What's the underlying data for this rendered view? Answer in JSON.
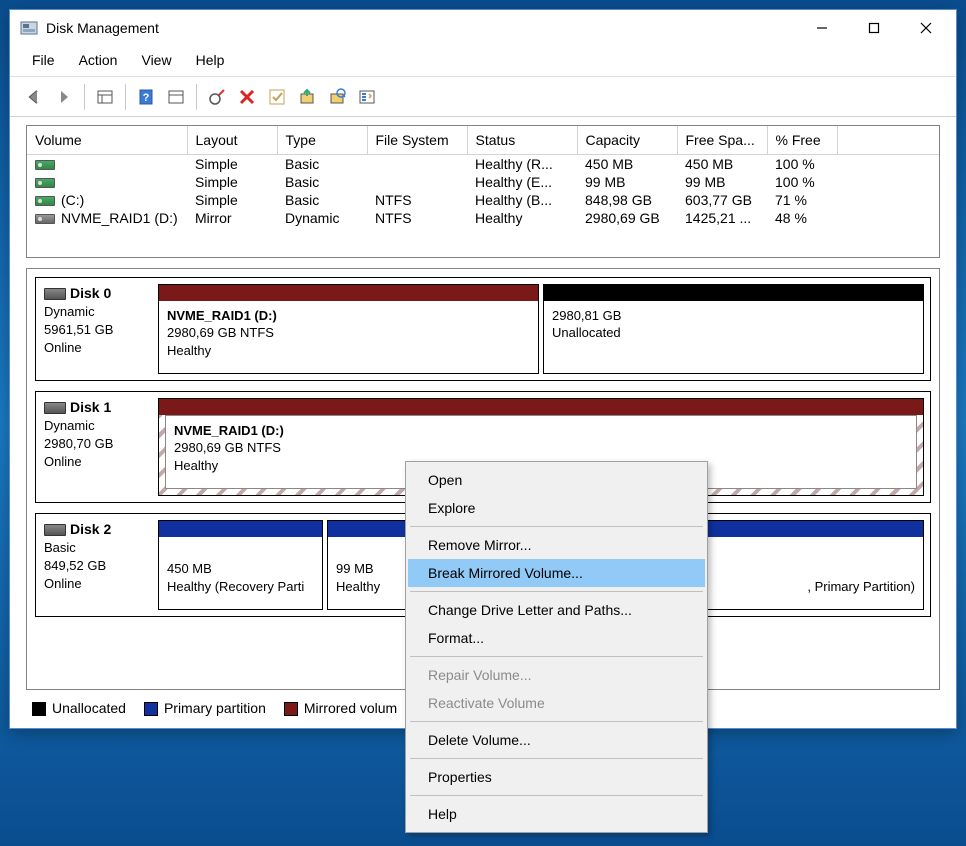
{
  "window": {
    "title": "Disk Management"
  },
  "menubar": [
    "File",
    "Action",
    "View",
    "Help"
  ],
  "columns": {
    "c0": "Volume",
    "c1": "Layout",
    "c2": "Type",
    "c3": "File System",
    "c4": "Status",
    "c5": "Capacity",
    "c6": "Free Spa...",
    "c7": "% Free"
  },
  "volumes": [
    {
      "name": "",
      "layout": "Simple",
      "type": "Basic",
      "fs": "",
      "status": "Healthy (R...",
      "cap": "450 MB",
      "free": "450 MB",
      "pct": "100 %",
      "icon": ""
    },
    {
      "name": "",
      "layout": "Simple",
      "type": "Basic",
      "fs": "",
      "status": "Healthy (E...",
      "cap": "99 MB",
      "free": "99 MB",
      "pct": "100 %",
      "icon": ""
    },
    {
      "name": "(C:)",
      "layout": "Simple",
      "type": "Basic",
      "fs": "NTFS",
      "status": "Healthy (B...",
      "cap": "848,98 GB",
      "free": "603,77 GB",
      "pct": "71 %",
      "icon": ""
    },
    {
      "name": "NVME_RAID1 (D:)",
      "layout": "Mirror",
      "type": "Dynamic",
      "fs": "NTFS",
      "status": "Healthy",
      "cap": "2980,69 GB",
      "free": "1425,21 ...",
      "pct": "48 %",
      "icon": "mirror"
    }
  ],
  "disks": {
    "d0": {
      "name": "Disk 0",
      "line1": "Dynamic",
      "line2": "5961,51 GB",
      "line3": "Online",
      "p0": {
        "title": "NVME_RAID1  (D:)",
        "line1": "2980,69 GB NTFS",
        "line2": "Healthy"
      },
      "p1": {
        "title": "",
        "line1": "2980,81 GB",
        "line2": "Unallocated"
      }
    },
    "d1": {
      "name": "Disk 1",
      "line1": "Dynamic",
      "line2": "2980,70 GB",
      "line3": "Online",
      "p0": {
        "title": "NVME_RAID1  (D:)",
        "line1": "2980,69 GB NTFS",
        "line2": "Healthy"
      }
    },
    "d2": {
      "name": "Disk 2",
      "line1": "Basic",
      "line2": "849,52 GB",
      "line3": "Online",
      "p0": {
        "title": "",
        "line1": "450 MB",
        "line2": "Healthy (Recovery Parti"
      },
      "p1": {
        "title": "",
        "line1": "99 MB",
        "line2": "Healthy"
      },
      "p2": {
        "title": "",
        "line1": "",
        "line2": ", Primary Partition)"
      }
    }
  },
  "legend": {
    "unalloc": "Unallocated",
    "primary": "Primary partition",
    "mirror": "Mirrored volum"
  },
  "context_menu": {
    "open": "Open",
    "explore": "Explore",
    "remove_mirror": "Remove Mirror...",
    "break_mirror": "Break Mirrored Volume...",
    "change_letter": "Change Drive Letter and Paths...",
    "format": "Format...",
    "repair": "Repair Volume...",
    "reactivate": "Reactivate Volume",
    "delete": "Delete Volume...",
    "properties": "Properties",
    "help": "Help"
  }
}
